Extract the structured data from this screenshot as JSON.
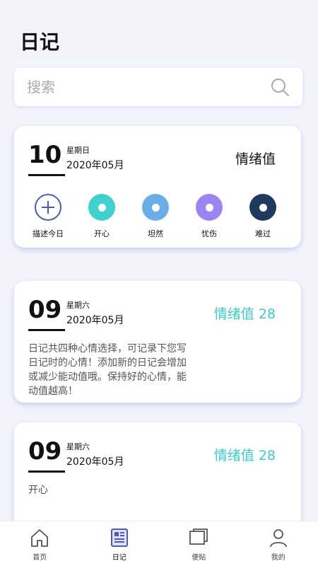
{
  "header": {
    "title": "日记"
  },
  "search": {
    "placeholder": "搜索",
    "value": ""
  },
  "today": {
    "day": "10",
    "weekday": "星期日",
    "year_month": "2020年05月",
    "mood_title": "情绪值",
    "moods": [
      {
        "label": "描述今日",
        "icon": "add-icon",
        "color": "#4a5ab8"
      },
      {
        "label": "开心",
        "icon": "happy-mood-icon",
        "color": "#3ed1cf"
      },
      {
        "label": "坦然",
        "icon": "calm-mood-icon",
        "color": "#6aaee8"
      },
      {
        "label": "忧伤",
        "icon": "sad-mood-icon",
        "color": "#9b85f3"
      },
      {
        "label": "难过",
        "icon": "upset-mood-icon",
        "color": "#1f3a5f"
      }
    ]
  },
  "entries": [
    {
      "day": "09",
      "weekday": "星期六",
      "year_month": "2020年05月",
      "mood_score": "情绪值 28",
      "text": "日记共四种心情选择，可记录下您写日记时的心情！添加新的日记会增加或减少能动值哦。保持好的心情，能动值越高！"
    },
    {
      "day": "09",
      "weekday": "星期六",
      "year_month": "2020年05月",
      "mood_score": "情绪值 28",
      "text": "开心"
    }
  ],
  "nav": {
    "items": [
      {
        "label": "首页",
        "icon": "home-icon"
      },
      {
        "label": "日记",
        "icon": "diary-icon"
      },
      {
        "label": "便贴",
        "icon": "sticky-note-icon"
      },
      {
        "label": "我的",
        "icon": "profile-icon"
      }
    ],
    "active_color": "#4a5ab8"
  }
}
